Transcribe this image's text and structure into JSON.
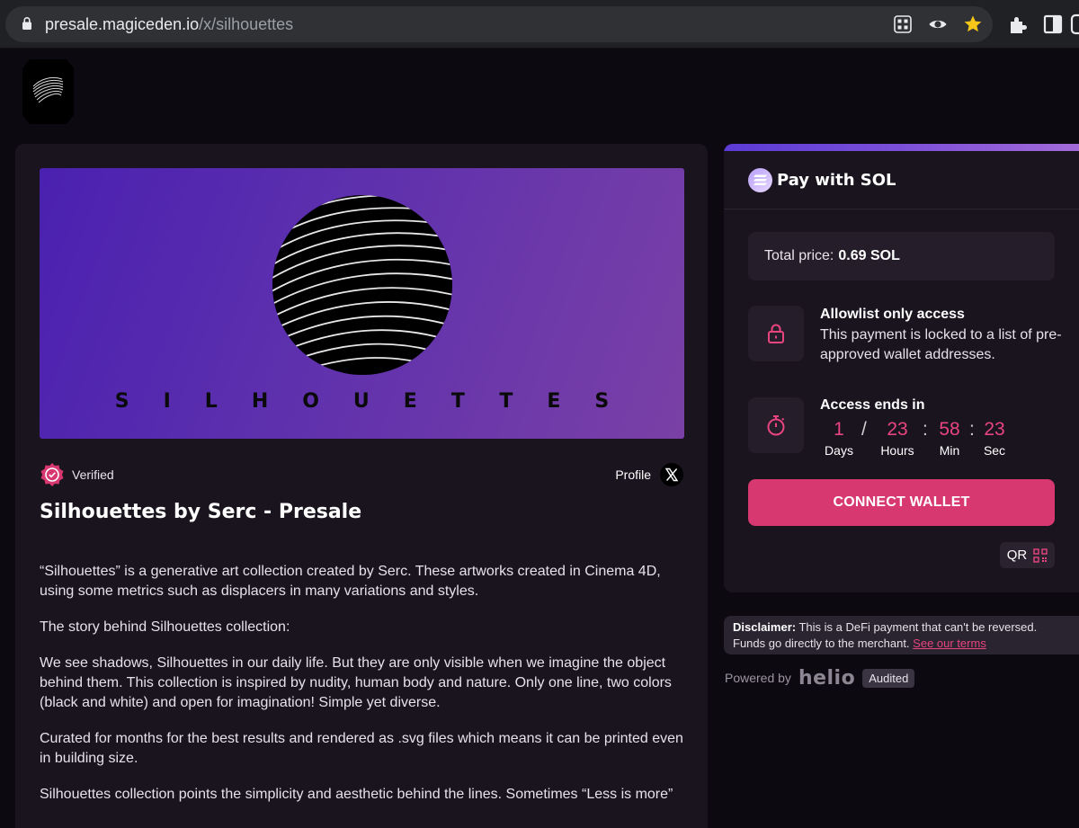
{
  "browser": {
    "url_host": "presale.magiceden.io",
    "url_path": "/x/silhouettes"
  },
  "banner": {
    "title": "SILHOUETTES"
  },
  "collection": {
    "verified_label": "Verified",
    "profile_label": "Profile",
    "title": "Silhouettes by Serc - Presale",
    "description": [
      "“Silhouettes” is a generative art collection created by Serc. These artworks created in Cinema 4D, using some metrics such as displacers in many variations and styles.",
      "The story behind Silhouettes collection:",
      "We see shadows, Silhouettes in our daily life. But they are only visible when we imagine the object behind them. This collection is inspired by nudity, human body and nature. Only one line, two colors (black and white) and open for imagination! Simple yet diverse.",
      "Curated for months for the best results and rendered as .svg files which means it can be printed even in building size.",
      "Silhouettes collection points the simplicity and aesthetic behind the lines. Sometimes “Less is more”"
    ]
  },
  "payment": {
    "title": "Pay with SOL",
    "price_label": "Total price:",
    "price_value": "0.69 SOL",
    "allowlist_title": "Allowlist only access",
    "allowlist_text": "This payment is locked to a list of pre-approved wallet addresses.",
    "access_title": "Access ends in",
    "countdown": [
      {
        "value": "1",
        "label": "Days"
      },
      {
        "value": "23",
        "label": "Hours"
      },
      {
        "value": "58",
        "label": "Min"
      },
      {
        "value": "23",
        "label": "Sec"
      }
    ],
    "separators": [
      "/",
      ":",
      ":"
    ],
    "connect_label": "CONNECT WALLET",
    "qr_label": "QR"
  },
  "footer": {
    "disclaimer_bold": "Disclaimer:",
    "disclaimer_text": "This is a DeFi payment that can't be reversed. Funds go directly to the merchant.",
    "terms_label": "See our terms",
    "powered_label": "Powered by",
    "helio_logo": "helio",
    "audited_label": "Audited"
  },
  "colors": {
    "page_bg": "#0d0910",
    "panel_bg": "#1a141f",
    "accent_pink": "#d6386f",
    "countdown_pink": "#e8457f"
  },
  "icons": {
    "lock": "lock-icon",
    "timer": "stopwatch-icon",
    "verified": "verified-badge-icon",
    "x": "x-logo-icon",
    "qr": "qr-code-icon"
  }
}
